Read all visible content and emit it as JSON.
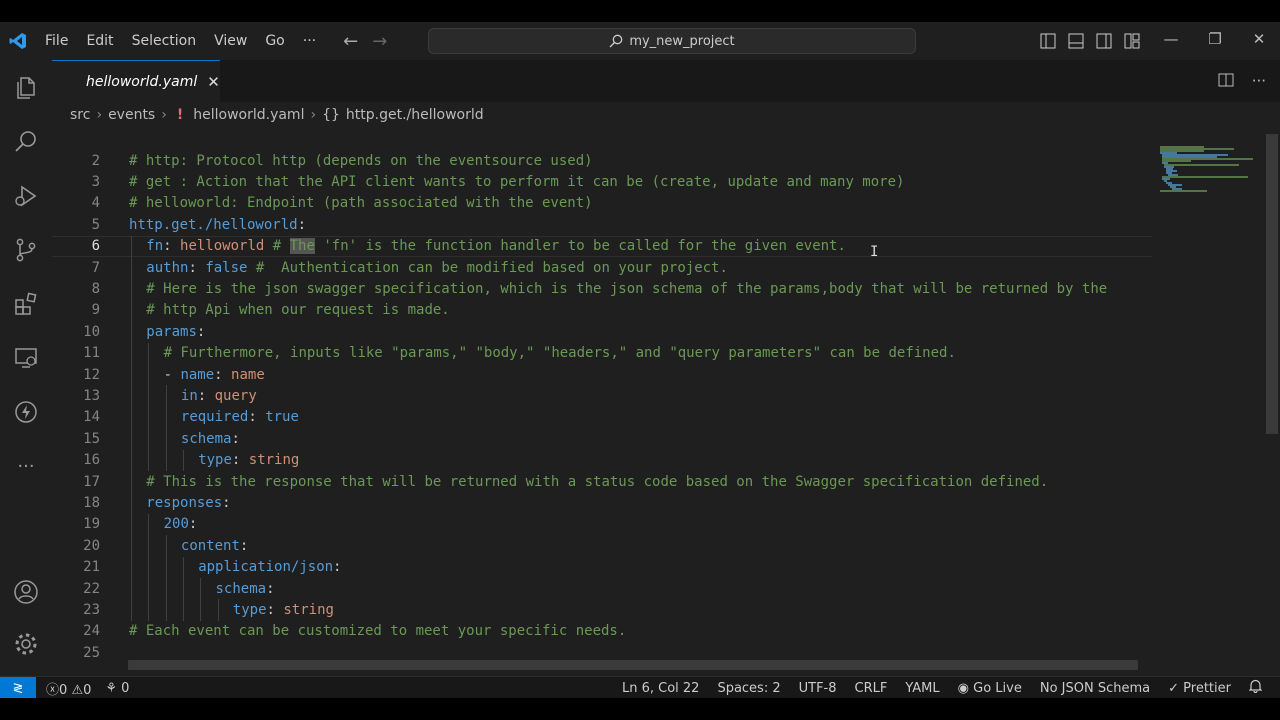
{
  "titlebar": {
    "menu": [
      "File",
      "Edit",
      "Selection",
      "View",
      "Go",
      "···"
    ],
    "search_text": "my_new_project"
  },
  "tab": {
    "name": "helloworld.yaml",
    "close": "✕"
  },
  "breadcrumb": {
    "items": [
      "src",
      "events",
      "helloworld.yaml",
      "http.get./helloworld"
    ],
    "bang": "!",
    "braces": "{}"
  },
  "editor": {
    "lines": [
      {
        "n": "2",
        "indent": 0,
        "segments": [
          {
            "t": "# http: Protocol http (depends on the eventsource used)",
            "c": "c"
          }
        ]
      },
      {
        "n": "3",
        "indent": 0,
        "segments": [
          {
            "t": "# get : Action that the API client wants to perform it can be (create, update and many more)",
            "c": "c"
          }
        ]
      },
      {
        "n": "4",
        "indent": 0,
        "segments": [
          {
            "t": "# helloworld: Endpoint (path associated with the event)",
            "c": "c"
          }
        ]
      },
      {
        "n": "5",
        "indent": 0,
        "segments": [
          {
            "t": "http.get./helloworld",
            "c": "k"
          },
          {
            "t": ":",
            "c": "p"
          }
        ]
      },
      {
        "n": "6",
        "indent": 1,
        "current": true,
        "segments": [
          {
            "t": "fn",
            "c": "k"
          },
          {
            "t": ": ",
            "c": "p"
          },
          {
            "t": "helloworld",
            "c": "v"
          },
          {
            "t": " # ",
            "c": "c"
          },
          {
            "t": "The",
            "c": "hl"
          },
          {
            "t": " 'fn' is the function handler to be called for the given event.",
            "c": "c"
          }
        ]
      },
      {
        "n": "7",
        "indent": 1,
        "segments": [
          {
            "t": "authn",
            "c": "k"
          },
          {
            "t": ": ",
            "c": "p"
          },
          {
            "t": "false",
            "c": "k"
          },
          {
            "t": " #  Authentication can be modified based on your project.",
            "c": "c"
          }
        ]
      },
      {
        "n": "8",
        "indent": 1,
        "segments": [
          {
            "t": "# Here is the json swagger specification, which is the json schema of the params,body that will be returned by the",
            "c": "c"
          }
        ]
      },
      {
        "n": "9",
        "indent": 1,
        "segments": [
          {
            "t": "# http Api when our request is made.",
            "c": "c"
          }
        ]
      },
      {
        "n": "10",
        "indent": 1,
        "segments": [
          {
            "t": "params",
            "c": "k"
          },
          {
            "t": ":",
            "c": "p"
          }
        ]
      },
      {
        "n": "11",
        "indent": 2,
        "segments": [
          {
            "t": "# Furthermore, inputs like \"params,\" \"body,\" \"headers,\" and \"query parameters\" can be defined.",
            "c": "c"
          }
        ]
      },
      {
        "n": "12",
        "indent": 2,
        "segments": [
          {
            "t": "- ",
            "c": "p"
          },
          {
            "t": "name",
            "c": "k"
          },
          {
            "t": ": ",
            "c": "p"
          },
          {
            "t": "name",
            "c": "v"
          }
        ]
      },
      {
        "n": "13",
        "indent": 3,
        "segments": [
          {
            "t": "in",
            "c": "k"
          },
          {
            "t": ": ",
            "c": "p"
          },
          {
            "t": "query",
            "c": "v"
          }
        ]
      },
      {
        "n": "14",
        "indent": 3,
        "segments": [
          {
            "t": "required",
            "c": "k"
          },
          {
            "t": ": ",
            "c": "p"
          },
          {
            "t": "true",
            "c": "k"
          }
        ]
      },
      {
        "n": "15",
        "indent": 3,
        "segments": [
          {
            "t": "schema",
            "c": "k"
          },
          {
            "t": ":",
            "c": "p"
          }
        ]
      },
      {
        "n": "16",
        "indent": 4,
        "segments": [
          {
            "t": "type",
            "c": "k"
          },
          {
            "t": ": ",
            "c": "p"
          },
          {
            "t": "string",
            "c": "v"
          }
        ]
      },
      {
        "n": "17",
        "indent": 1,
        "segments": [
          {
            "t": "# This is the response that will be returned with a status code based on the Swagger specification defined.",
            "c": "c"
          }
        ]
      },
      {
        "n": "18",
        "indent": 1,
        "segments": [
          {
            "t": "responses",
            "c": "k"
          },
          {
            "t": ":",
            "c": "p"
          }
        ]
      },
      {
        "n": "19",
        "indent": 2,
        "segments": [
          {
            "t": "200",
            "c": "k"
          },
          {
            "t": ":",
            "c": "p"
          }
        ]
      },
      {
        "n": "20",
        "indent": 3,
        "segments": [
          {
            "t": "content",
            "c": "k"
          },
          {
            "t": ":",
            "c": "p"
          }
        ]
      },
      {
        "n": "21",
        "indent": 4,
        "segments": [
          {
            "t": "application/json",
            "c": "k"
          },
          {
            "t": ":",
            "c": "p"
          }
        ]
      },
      {
        "n": "22",
        "indent": 5,
        "segments": [
          {
            "t": "schema",
            "c": "k"
          },
          {
            "t": ":",
            "c": "p"
          }
        ]
      },
      {
        "n": "23",
        "indent": 6,
        "segments": [
          {
            "t": "type",
            "c": "k"
          },
          {
            "t": ": ",
            "c": "p"
          },
          {
            "t": "string",
            "c": "v"
          }
        ]
      },
      {
        "n": "24",
        "indent": 0,
        "segments": [
          {
            "t": "# Each event can be customized to meet your specific needs.",
            "c": "c"
          }
        ]
      },
      {
        "n": "25",
        "indent": 0,
        "segments": []
      }
    ],
    "cursor_glyph": "I"
  },
  "status": {
    "remote": "≷",
    "errors": "0",
    "warnings": "0",
    "ports": "0",
    "position": "Ln 6, Col 22",
    "spaces": "Spaces: 2",
    "encoding": "UTF-8",
    "eol": "CRLF",
    "language": "YAML",
    "golive": "Go Live",
    "schema": "No JSON Schema",
    "prettier": "Prettier"
  },
  "colors": {
    "accent": "#0078d4",
    "comment": "#6a9955",
    "key": "#569cd6",
    "string": "#ce9178"
  }
}
